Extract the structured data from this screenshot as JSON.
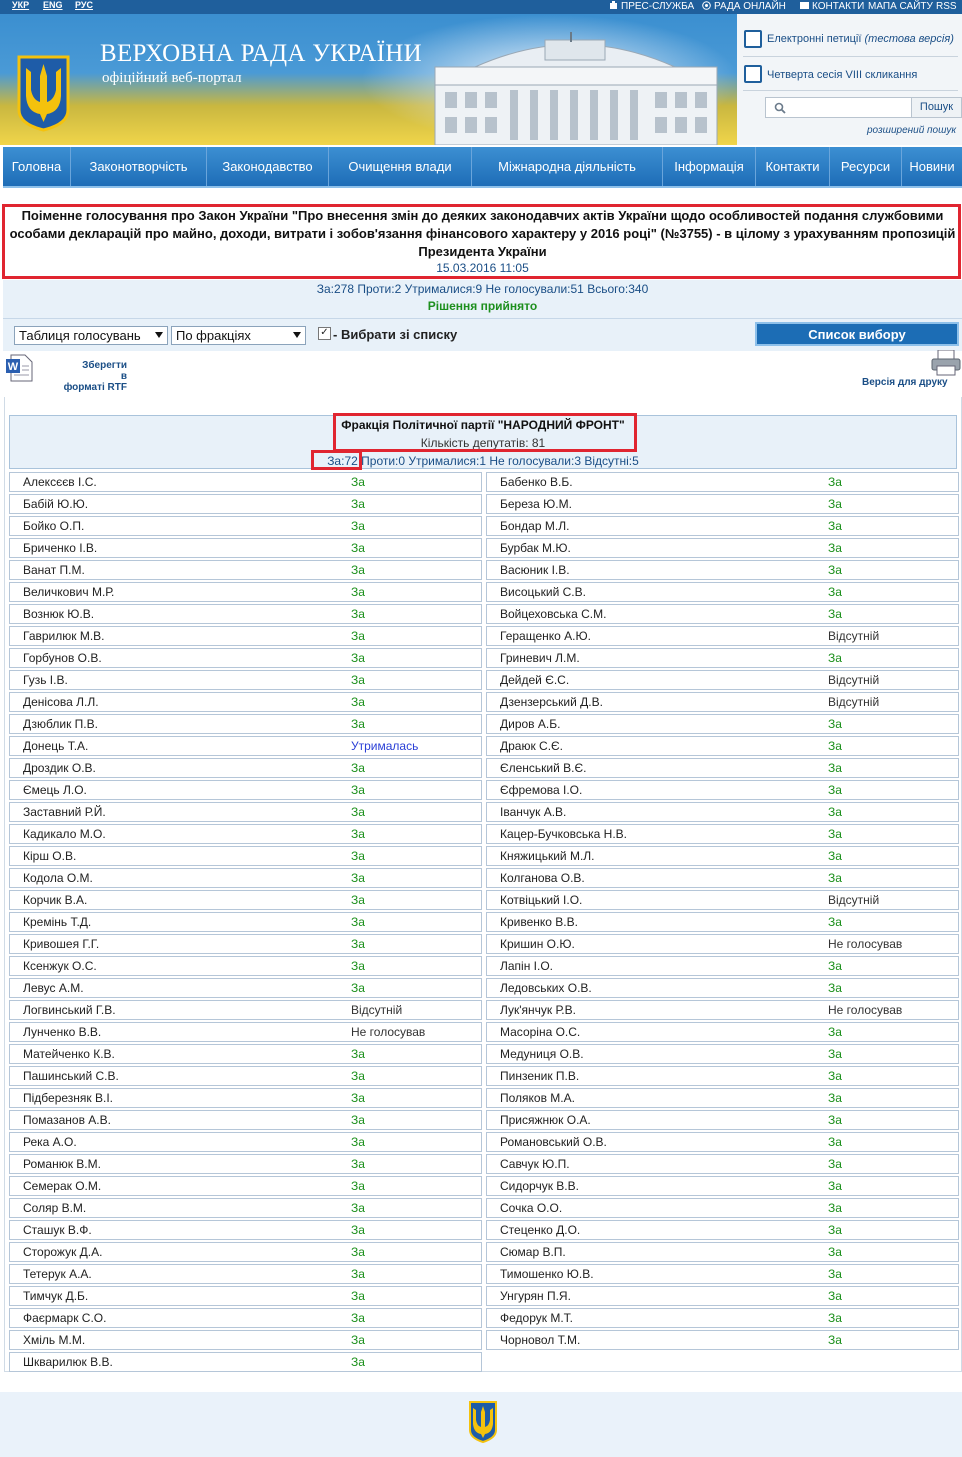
{
  "topbar": {
    "langs": [
      "УКР",
      "ENG",
      "РУС"
    ],
    "links": [
      "ПРЕС-СЛУЖБА",
      "РАДА ОНЛАЙН",
      "КОНТАКТИ",
      "МАПА САЙТУ",
      "RSS"
    ]
  },
  "header": {
    "title": "ВЕРХОВНА РАДА УКРАЇНИ",
    "subtitle": "офіційний веб-портал",
    "petitions": "Електронні петиції",
    "petitions_note": "(тестова версія)",
    "session": "Четверта сесія VIII скликання",
    "search_button": "Пошук",
    "advanced_search": "розширений пошук"
  },
  "nav": [
    "Головна",
    "Законотворчість",
    "Законодавство",
    "Очищення влади",
    "Міжнародна діяльність",
    "Інформація",
    "Контакти",
    "Ресурси",
    "Новини"
  ],
  "vote": {
    "title_line1": "Поіменне голосування про Закон України \"Про внесення змін до деяких законодавчих актів України щодо особливостей подання службовими",
    "title_line2": "особами декларацій про майно, доходи, витрати і зобов'язання фінансового характеру у 2016 році\" (№3755) - в цілому з урахуванням пропозицій",
    "title_line3": "Президента України",
    "datetime": "15.03.2016 11:05",
    "summary": "За:278 Проти:2 Утрималися:9 Не голосували:51 Всього:340",
    "decision": "Рішення прийнято"
  },
  "controls": {
    "view_select": "Таблиця голосувань",
    "group_select": "По фракціях",
    "checkbox_label": "- Вибрати зі списку",
    "list_button": "Список вибору",
    "save_rtf": [
      "Зберегти",
      "в",
      "форматі RTF"
    ],
    "print_version": "Версія для друку"
  },
  "faction": {
    "name": "Фракція Політичної партії \"НАРОДНИЙ ФРОНТ\"",
    "count": "Кількість депутатів: 81",
    "stat_za": "За:72",
    "stat_rest": "Проти:0 Утрималися:1 Не голосували:3 Відсутні:5"
  },
  "deputies_left": [
    {
      "name": "Алексєєв І.С.",
      "vote": "За"
    },
    {
      "name": "Бабій Ю.Ю.",
      "vote": "За"
    },
    {
      "name": "Бойко О.П.",
      "vote": "За"
    },
    {
      "name": "Бриченко І.В.",
      "vote": "За"
    },
    {
      "name": "Ванат П.М.",
      "vote": "За"
    },
    {
      "name": "Величкович М.Р.",
      "vote": "За"
    },
    {
      "name": "Вознюк Ю.В.",
      "vote": "За"
    },
    {
      "name": "Гаврилюк М.В.",
      "vote": "За"
    },
    {
      "name": "Горбунов О.В.",
      "vote": "За"
    },
    {
      "name": "Гузь І.В.",
      "vote": "За"
    },
    {
      "name": "Денісова Л.Л.",
      "vote": "За"
    },
    {
      "name": "Дзюблик П.В.",
      "vote": "За"
    },
    {
      "name": "Донець Т.А.",
      "vote": "Утрималась"
    },
    {
      "name": "Дроздик О.В.",
      "vote": "За"
    },
    {
      "name": "Ємець Л.О.",
      "vote": "За"
    },
    {
      "name": "Заставний Р.Й.",
      "vote": "За"
    },
    {
      "name": "Кадикало М.О.",
      "vote": "За"
    },
    {
      "name": "Кірш О.В.",
      "vote": "За"
    },
    {
      "name": "Кодола О.М.",
      "vote": "За"
    },
    {
      "name": "Корчик В.А.",
      "vote": "За"
    },
    {
      "name": "Кремінь Т.Д.",
      "vote": "За"
    },
    {
      "name": "Кривошея Г.Г.",
      "vote": "За"
    },
    {
      "name": "Ксенжук О.С.",
      "vote": "За"
    },
    {
      "name": "Левус А.М.",
      "vote": "За"
    },
    {
      "name": "Логвинський Г.В.",
      "vote": "Відсутній"
    },
    {
      "name": "Лунченко В.В.",
      "vote": "Не голосував"
    },
    {
      "name": "Матейченко К.В.",
      "vote": "За"
    },
    {
      "name": "Пашинський С.В.",
      "vote": "За"
    },
    {
      "name": "Підберезняк В.І.",
      "vote": "За"
    },
    {
      "name": "Помазанов А.В.",
      "vote": "За"
    },
    {
      "name": "Река А.О.",
      "vote": "За"
    },
    {
      "name": "Романюк В.М.",
      "vote": "За"
    },
    {
      "name": "Семерак О.М.",
      "vote": "За"
    },
    {
      "name": "Соляр В.М.",
      "vote": "За"
    },
    {
      "name": "Сташук В.Ф.",
      "vote": "За"
    },
    {
      "name": "Сторожук Д.А.",
      "vote": "За"
    },
    {
      "name": "Тетерук А.А.",
      "vote": "За"
    },
    {
      "name": "Тимчук Д.Б.",
      "vote": "За"
    },
    {
      "name": "Фаєрмарк С.О.",
      "vote": "За"
    },
    {
      "name": "Хміль М.М.",
      "vote": "За"
    },
    {
      "name": "Шкварилюк В.В.",
      "vote": "За"
    }
  ],
  "deputies_right": [
    {
      "name": "Бабенко В.Б.",
      "vote": "За"
    },
    {
      "name": "Береза Ю.М.",
      "vote": "За"
    },
    {
      "name": "Бондар М.Л.",
      "vote": "За"
    },
    {
      "name": "Бурбак М.Ю.",
      "vote": "За"
    },
    {
      "name": "Васюник І.В.",
      "vote": "За"
    },
    {
      "name": "Висоцький С.В.",
      "vote": "За"
    },
    {
      "name": "Войцеховська С.М.",
      "vote": "За"
    },
    {
      "name": "Геращенко А.Ю.",
      "vote": "Відсутній"
    },
    {
      "name": "Гриневич Л.М.",
      "vote": "За"
    },
    {
      "name": "Дейдей Є.С.",
      "vote": "Відсутній"
    },
    {
      "name": "Дзензерський Д.В.",
      "vote": "Відсутній"
    },
    {
      "name": "Диров А.Б.",
      "vote": "За"
    },
    {
      "name": "Драюк С.Є.",
      "vote": "За"
    },
    {
      "name": "Єленський В.Є.",
      "vote": "За"
    },
    {
      "name": "Єфремова І.О.",
      "vote": "За"
    },
    {
      "name": "Іванчук А.В.",
      "vote": "За"
    },
    {
      "name": "Кацер-Бучковська Н.В.",
      "vote": "За"
    },
    {
      "name": "Княжицький М.Л.",
      "vote": "За"
    },
    {
      "name": "Колганова О.В.",
      "vote": "За"
    },
    {
      "name": "Котвіцький І.О.",
      "vote": "Відсутній"
    },
    {
      "name": "Кривенко В.В.",
      "vote": "За"
    },
    {
      "name": "Кришин О.Ю.",
      "vote": "Не голосував"
    },
    {
      "name": "Лапін І.О.",
      "vote": "За"
    },
    {
      "name": "Ледовських О.В.",
      "vote": "За"
    },
    {
      "name": "Лук'янчук Р.В.",
      "vote": "Не голосував"
    },
    {
      "name": "Масоріна О.С.",
      "vote": "За"
    },
    {
      "name": "Медуниця О.В.",
      "vote": "За"
    },
    {
      "name": "Пинзеник П.В.",
      "vote": "За"
    },
    {
      "name": "Поляков М.А.",
      "vote": "За"
    },
    {
      "name": "Присяжнюк О.А.",
      "vote": "За"
    },
    {
      "name": "Романовський О.В.",
      "vote": "За"
    },
    {
      "name": "Савчук Ю.П.",
      "vote": "За"
    },
    {
      "name": "Сидорчук В.В.",
      "vote": "За"
    },
    {
      "name": "Сочка О.О.",
      "vote": "За"
    },
    {
      "name": "Стеценко Д.О.",
      "vote": "За"
    },
    {
      "name": "Сюмар В.П.",
      "vote": "За"
    },
    {
      "name": "Тимошенко Ю.В.",
      "vote": "За"
    },
    {
      "name": "Унгурян П.Я.",
      "vote": "За"
    },
    {
      "name": "Федорук М.Т.",
      "vote": "За"
    },
    {
      "name": "Чорновол Т.М.",
      "vote": "За"
    }
  ],
  "colors": {
    "vote_for": "#1a8f1a",
    "abstained": "#2a3fd6",
    "highlight_box": "#e02530",
    "nav": "#1e6db7"
  }
}
